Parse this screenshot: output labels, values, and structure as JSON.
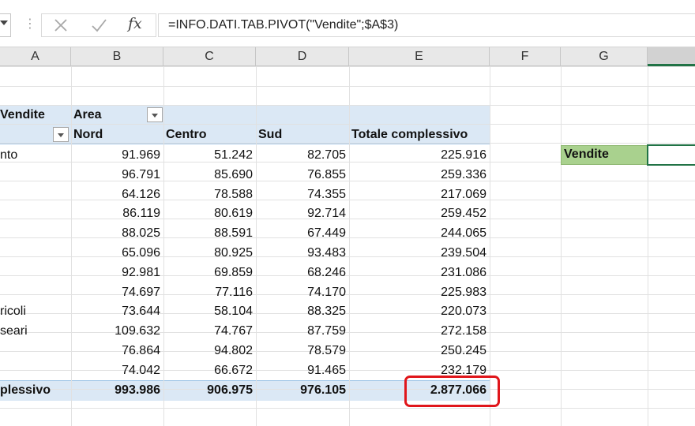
{
  "formula_bar": {
    "dots": "⋮",
    "fx": "fx",
    "formula": "=INFO.DATI.TAB.PIVOT(\"Vendite\";$A$3)"
  },
  "columns": [
    "A",
    "B",
    "C",
    "D",
    "E",
    "F",
    "G",
    ""
  ],
  "pivot": {
    "values_label": "Vendite",
    "column_field": "Area",
    "col_headers": [
      "Nord",
      "Centro",
      "Sud",
      "Totale complessivo"
    ],
    "rows": [
      {
        "label": "nto",
        "values": [
          "91.969",
          "51.242",
          "82.705",
          "225.916"
        ]
      },
      {
        "label": "",
        "values": [
          "96.791",
          "85.690",
          "76.855",
          "259.336"
        ]
      },
      {
        "label": "",
        "values": [
          "64.126",
          "78.588",
          "74.355",
          "217.069"
        ]
      },
      {
        "label": "",
        "values": [
          "86.119",
          "80.619",
          "92.714",
          "259.452"
        ]
      },
      {
        "label": "",
        "values": [
          "88.025",
          "88.591",
          "67.449",
          "244.065"
        ]
      },
      {
        "label": "",
        "values": [
          "65.096",
          "80.925",
          "93.483",
          "239.504"
        ]
      },
      {
        "label": "",
        "values": [
          "92.981",
          "69.859",
          "68.246",
          "231.086"
        ]
      },
      {
        "label": "",
        "values": [
          "74.697",
          "77.116",
          "74.170",
          "225.983"
        ]
      },
      {
        "label": "ricoli",
        "values": [
          "73.644",
          "58.104",
          "88.325",
          "220.073"
        ]
      },
      {
        "label": "seari",
        "values": [
          "109.632",
          "74.767",
          "87.759",
          "272.158"
        ]
      },
      {
        "label": "",
        "values": [
          "76.864",
          "94.802",
          "78.579",
          "250.245"
        ]
      },
      {
        "label": "",
        "values": [
          "74.042",
          "66.672",
          "91.465",
          "232.179"
        ]
      }
    ],
    "total_label": "plessivo",
    "totals": [
      "993.986",
      "906.975",
      "976.105",
      "2.877.066"
    ]
  },
  "g_cell_label": "Vendite",
  "colors": {
    "pivot_header": "#dbe8f5",
    "selection_green": "#217346",
    "label_green": "#a9d18e",
    "highlight_red": "#e0161b"
  },
  "icons": {
    "cancel": "cancel-x-icon",
    "enter": "check-icon",
    "namebox_dropdown": "chevron-down-icon",
    "filter": "filter-dropdown-icon"
  }
}
